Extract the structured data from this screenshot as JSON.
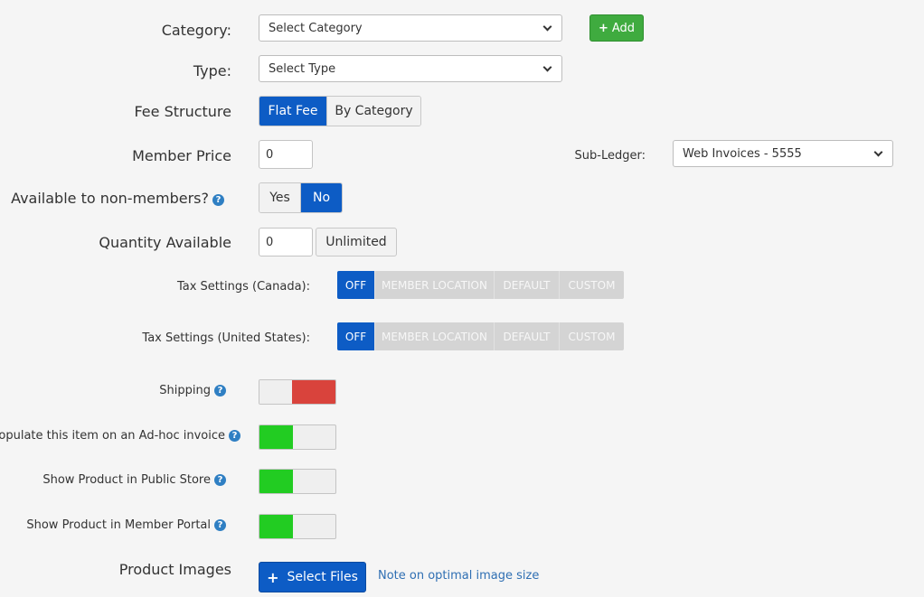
{
  "category": {
    "label": "Category:",
    "selected": "Select Category",
    "add_label": "Add"
  },
  "type": {
    "label": "Type:",
    "selected": "Select Type"
  },
  "fee_structure": {
    "label": "Fee Structure",
    "options": [
      "Flat Fee",
      "By Category"
    ],
    "active": "Flat Fee"
  },
  "member_price": {
    "label": "Member Price",
    "value": "0"
  },
  "sub_ledger": {
    "label": "Sub-Ledger:",
    "selected": "Web Invoices - 5555"
  },
  "non_members": {
    "label": "Available to non-members?",
    "options": [
      "Yes",
      "No"
    ],
    "active": "No"
  },
  "quantity": {
    "label": "Quantity Available",
    "value": "0",
    "unlimited_label": "Unlimited"
  },
  "tax_canada": {
    "label": "Tax Settings (Canada):",
    "options": [
      "OFF",
      "MEMBER LOCATION",
      "DEFAULT",
      "CUSTOM"
    ],
    "active": "OFF"
  },
  "tax_us": {
    "label": "Tax Settings (United States):",
    "options": [
      "OFF",
      "MEMBER LOCATION",
      "DEFAULT",
      "CUSTOM"
    ],
    "active": "OFF"
  },
  "shipping": {
    "label": "Shipping",
    "enabled": false
  },
  "adhoc": {
    "label": "Populate this item on an Ad-hoc invoice",
    "enabled": true
  },
  "public_store": {
    "label": "Show Product in Public Store",
    "enabled": true
  },
  "member_portal": {
    "label": "Show Product in Member Portal",
    "enabled": true
  },
  "product_images": {
    "label": "Product Images",
    "button_label": "Select Files",
    "note_link": "Note on optimal image size"
  },
  "colors": {
    "primary": "#0d5cc5",
    "success": "#3fab3f",
    "toggle_on": "#22cc22",
    "toggle_off": "#d9433c",
    "help": "#2f7fc3"
  },
  "icons": {
    "help": "question-circle-icon",
    "add": "plus-icon",
    "dropdown": "chevron-down-icon"
  }
}
